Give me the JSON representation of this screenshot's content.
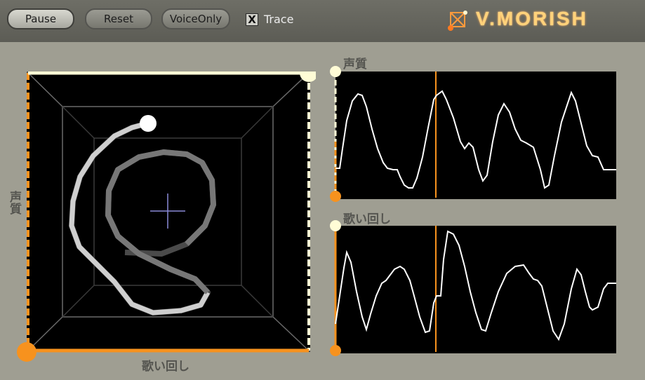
{
  "toolbar": {
    "pause_label": "Pause",
    "reset_label": "Reset",
    "voiceonly_label": "VoiceOnly",
    "trace_label": "Trace",
    "trace_checked_mark": "X"
  },
  "brand": {
    "name": "V.MORISH",
    "icon": "cube-logo-icon"
  },
  "xy_pad": {
    "x_axis_label": "歌い回し",
    "y_axis_label": "声質"
  },
  "waves": [
    {
      "label": "声質"
    },
    {
      "label": "歌い回し"
    }
  ],
  "colors": {
    "accent": "#f7921e",
    "handle": "#fffcd6",
    "background": "#9f9e92",
    "panel": "#000000"
  }
}
